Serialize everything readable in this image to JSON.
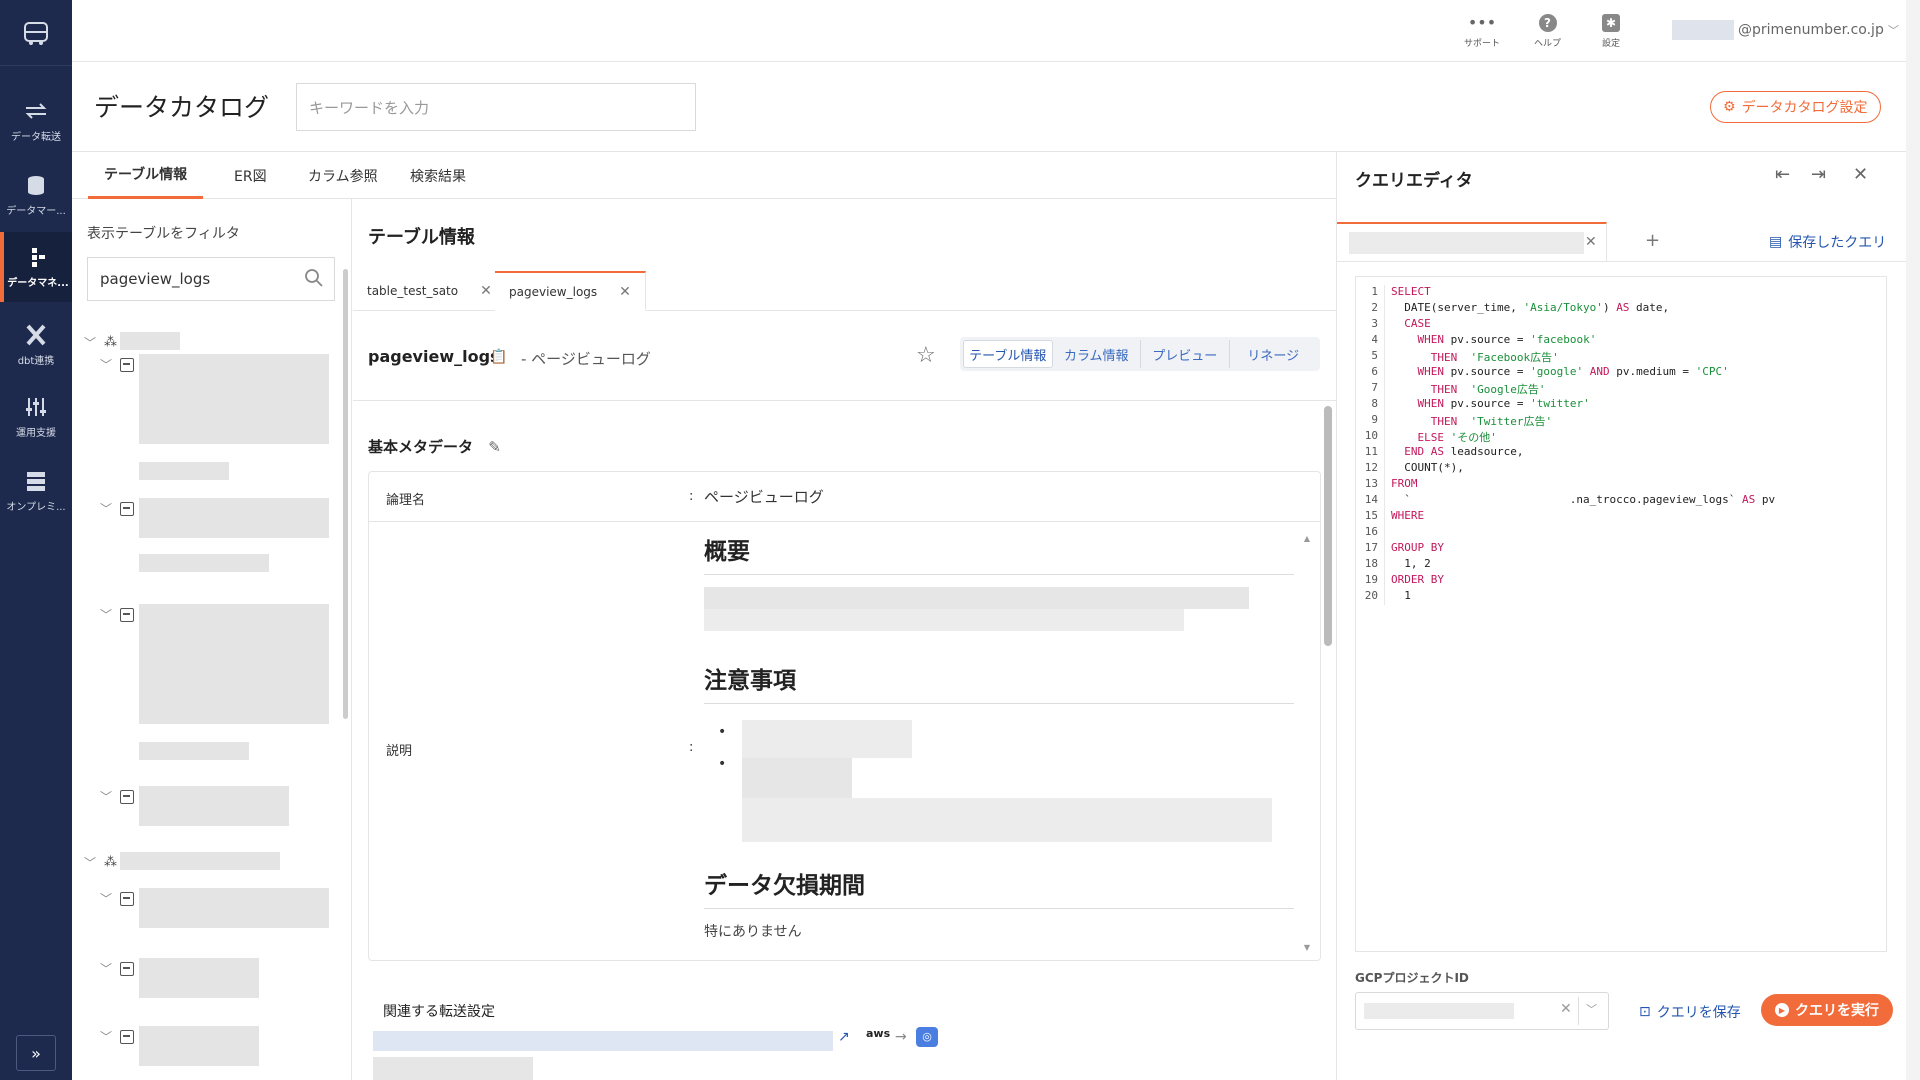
{
  "sidebar": {
    "items": [
      {
        "label": "データ転送",
        "icon": "transfer-icon"
      },
      {
        "label": "データマー...",
        "icon": "database-icon"
      },
      {
        "label": "データマネ...",
        "icon": "catalog-icon"
      },
      {
        "label": "dbt連携",
        "icon": "dbt-icon"
      },
      {
        "label": "運用支援",
        "icon": "ops-icon"
      },
      {
        "label": "オンプレミ...",
        "icon": "server-icon"
      }
    ],
    "expand_label": "»"
  },
  "topbar": {
    "support_label": "サポート",
    "help_label": "ヘルプ",
    "settings_label": "設定",
    "user_email": "@primenumber.co.jp"
  },
  "page": {
    "title": "データカタログ",
    "keyword_placeholder": "キーワードを入力",
    "catalog_settings_label": "データカタログ設定"
  },
  "main_tabs": [
    "テーブル情報",
    "ER図",
    "カラム参照",
    "検索結果"
  ],
  "filter": {
    "title": "表示テーブルをフィルタ",
    "value": "pageview_logs"
  },
  "content": {
    "section_title": "テーブル情報",
    "doc_tabs": [
      "table_test_sato",
      "pageview_logs"
    ],
    "table_name": "pageview_logs",
    "table_subtitle": "- ページビューログ",
    "segments": [
      "テーブル情報",
      "カラム情報",
      "プレビュー",
      "リネージ"
    ],
    "meta_title": "基本メタデータ",
    "logical_name_label": "論理名",
    "logical_name_value": "ページビューログ",
    "description_label": "説明",
    "colon": ":",
    "desc_heading_1": "概要",
    "desc_heading_2": "注意事項",
    "desc_heading_3": "データ欠損期間",
    "desc_text_3": "特にありません",
    "related_title": "関連する転送設定",
    "aws_label": "aws"
  },
  "query_editor": {
    "title": "クエリエディタ",
    "saved_queries_label": "保存したクエリ",
    "gcp_label": "GCPプロジェクトID",
    "save_label": "クエリを保存",
    "run_label": "クエリを実行",
    "code_lines": [
      {
        "n": "1",
        "t": "SELECT"
      },
      {
        "n": "2",
        "t": "  DATE(server_time, 'Asia/Tokyo') AS date,"
      },
      {
        "n": "3",
        "t": "  CASE"
      },
      {
        "n": "4",
        "t": "    WHEN pv.source = 'facebook'"
      },
      {
        "n": "5",
        "t": "      THEN  'Facebook広告'"
      },
      {
        "n": "6",
        "t": "    WHEN pv.source = 'google' AND pv.medium = 'CPC'"
      },
      {
        "n": "7",
        "t": "      THEN  'Google広告'"
      },
      {
        "n": "8",
        "t": "    WHEN pv.source = 'twitter'"
      },
      {
        "n": "9",
        "t": "      THEN  'Twitter広告'"
      },
      {
        "n": "10",
        "t": "    ELSE 'その他'"
      },
      {
        "n": "11",
        "t": "  END AS leadsource,"
      },
      {
        "n": "12",
        "t": "  COUNT(*),"
      },
      {
        "n": "13",
        "t": "FROM"
      },
      {
        "n": "14",
        "t": "  `                        .na_trocco.pageview_logs` AS pv"
      },
      {
        "n": "15",
        "t": "WHERE"
      },
      {
        "n": "16",
        "t": ""
      },
      {
        "n": "17",
        "t": "GROUP BY"
      },
      {
        "n": "18",
        "t": "  1, 2"
      },
      {
        "n": "19",
        "t": "ORDER BY"
      },
      {
        "n": "20",
        "t": "  1"
      }
    ]
  },
  "colors": {
    "sidebar_bg": "#1d2a4d",
    "accent": "#f26b3a",
    "link": "#2456b0"
  }
}
